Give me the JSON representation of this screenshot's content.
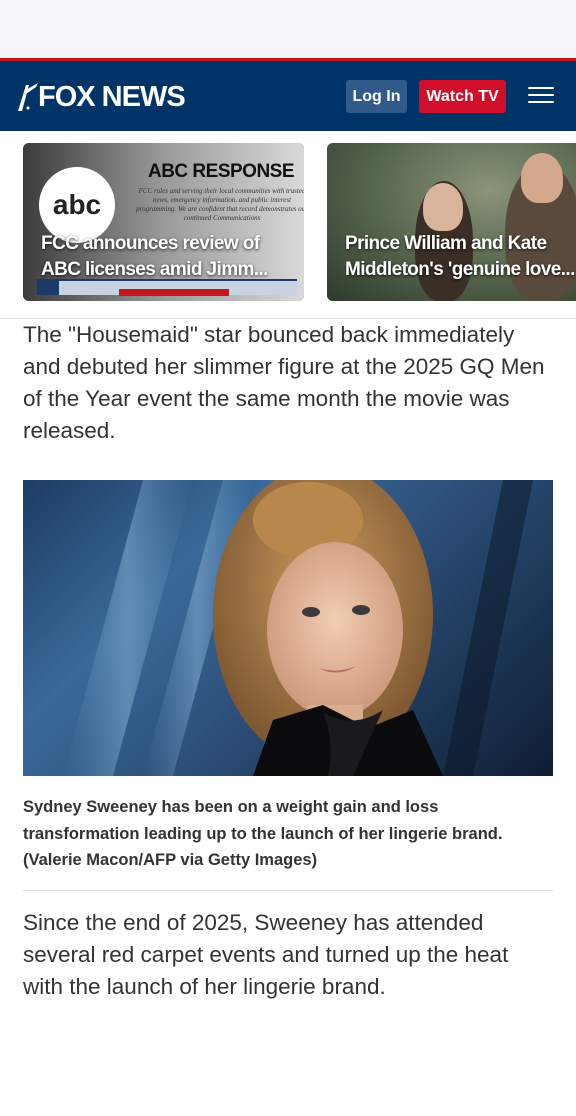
{
  "header": {
    "logo": "FOX NEWS",
    "login_label": "Log In",
    "watch_label": "Watch TV",
    "colors": {
      "navy": "#003366",
      "red": "#d20f2a",
      "login": "#2f5a8a"
    }
  },
  "carousel": [
    {
      "title_line1": "FCC announces review of",
      "title_line2": "ABC licenses amid Jimm...",
      "image": {
        "heading": "ABC RESPONSE",
        "logo": "abc",
        "fine_print": "FCC rules and serving their local communities with trusted news, emergency information, and public interest programming. We are confident that record demonstrates our continued Communications"
      }
    },
    {
      "title_line1": "Prince William and Kate",
      "title_line2": "Middleton's 'genuine love..."
    }
  ],
  "article": {
    "paragraph_1": "The \"Housemaid\" star bounced back immediately and debuted her slimmer figure at the 2025 GQ Men of the Year event the same month the movie was released.",
    "caption": "Sydney Sweeney has been on a weight gain and loss transformation leading up to the launch of her lingerie brand. (Valerie Macon/AFP via Getty Images)",
    "paragraph_2": "Since the end of 2025, Sweeney has attended several red carpet events and turned up the heat with the launch of her lingerie brand."
  }
}
